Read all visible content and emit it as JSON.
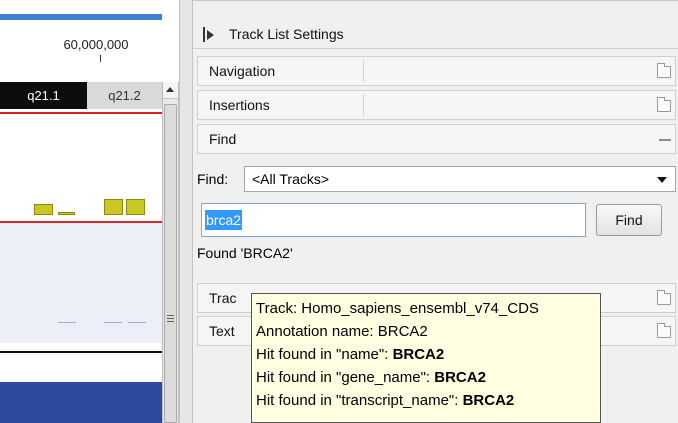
{
  "genome": {
    "coordinate": "60,000,000",
    "bands": [
      "q21.1",
      "q21.2"
    ]
  },
  "panel": {
    "title": "Track List Settings",
    "sections": {
      "navigation": "Navigation",
      "insertions": "Insertions",
      "find": "Find",
      "tracks": "Trac",
      "text": "Text"
    },
    "find": {
      "label": "Find:",
      "dropdown_value": "<All Tracks>",
      "query": "brca2",
      "button": "Find",
      "result": "Found 'BRCA2'"
    }
  },
  "tooltip": {
    "track": "Track: Homo_sapiens_ensembl_v74_CDS",
    "annotation": "Annotation name: BRCA2",
    "hit1_prefix": "Hit found in \"name\": ",
    "hit1_value": "BRCA2",
    "hit2_prefix": "Hit found in \"gene_name\": ",
    "hit2_value": "BRCA2",
    "hit3_prefix": "Hit found in \"transcript_name\": ",
    "hit3_value": "BRCA2"
  },
  "colors": {
    "band_dark": "#0c0c0c",
    "band_light": "#d9d9d9",
    "feature": "#c9c724",
    "red_line": "#dd2222",
    "blue_track": "#2d4a9c",
    "tooltip_bg": "#ffffe1",
    "selection": "#3399ff"
  }
}
